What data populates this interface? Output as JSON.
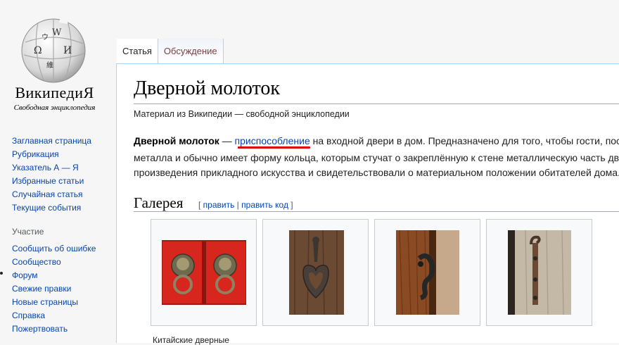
{
  "logo": {
    "wordmark": "ВикипедиЯ",
    "tagline": "Свободная энциклопедия",
    "glyphs": [
      "W",
      "Ω",
      "И",
      "維",
      "ウ"
    ]
  },
  "nav_main": [
    "Заглавная страница",
    "Рубрикация",
    "Указатель А — Я",
    "Избранные статьи",
    "Случайная статья",
    "Текущие события"
  ],
  "nav_participation": {
    "heading": "Участие",
    "items": [
      "Сообщить об ошибке",
      "Сообщество",
      "Форум",
      "Свежие правки",
      "Новые страницы",
      "Справка",
      "Пожертвовать"
    ]
  },
  "tabs": {
    "article": "Статья",
    "talk": "Обсуждение"
  },
  "article": {
    "title": "Дверной молоток",
    "from": "Материал из Википедии — свободной энциклопедии",
    "p1_bold": "Дверной молоток",
    "p1_dash": " — ",
    "p1_link": "приспособление",
    "p1_rest": " на входной двери в дом. Предназначено для того, чтобы гости, пос",
    "p2": "металла и обычно имеет форму кольца, которым стучат о закреплённую к стене металлическую часть дв",
    "p3": "произведения прикладного искусства и свидетельствовали о материальном положении обитателей дома."
  },
  "gallery": {
    "heading": "Галерея",
    "open": "[ ",
    "edit": "править",
    "sep": " | ",
    "edit_source": "править код",
    "close": " ]",
    "caption": "Китайские дверные"
  },
  "colors": {
    "link": "#0645ad",
    "talk_tab": "#794044",
    "border": "#a7d7f9",
    "underline": "#d00000"
  }
}
